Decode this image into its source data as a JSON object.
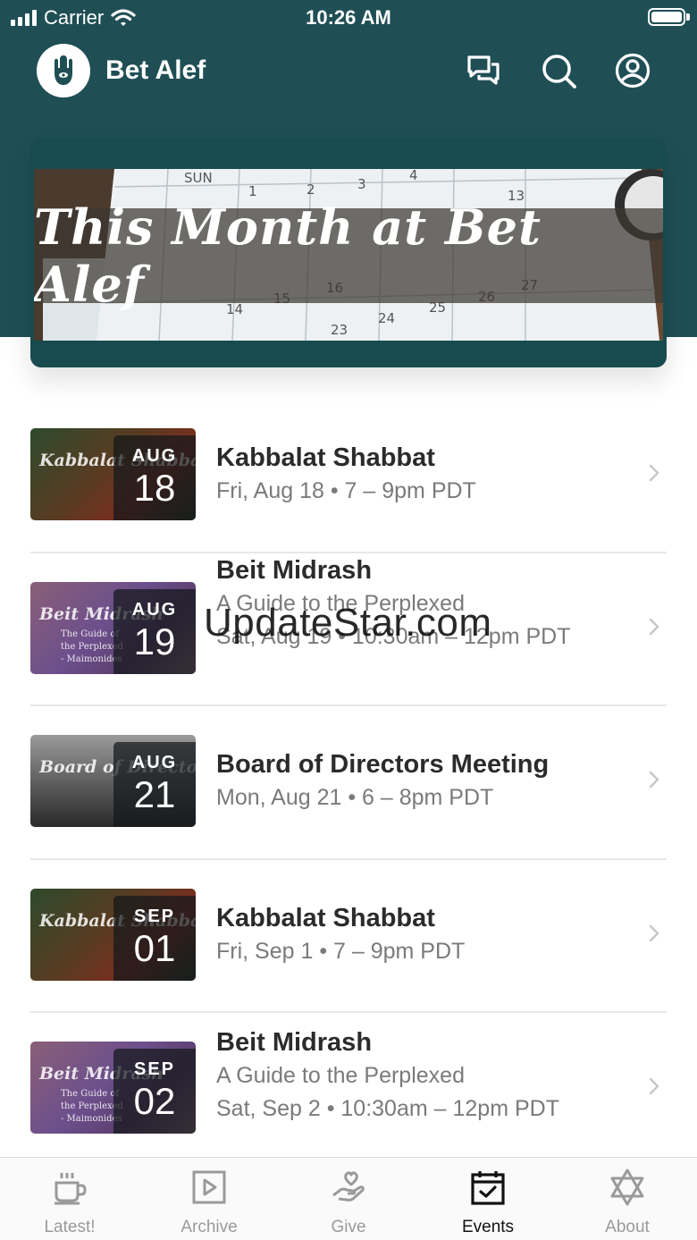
{
  "status_bar": {
    "carrier": "Carrier",
    "time": "10:26 AM"
  },
  "app": {
    "title": "Bet Alef"
  },
  "banner": {
    "title": "This Month at Bet Alef"
  },
  "events": [
    {
      "month": "AUG",
      "day": "18",
      "title": "Kabbalat Shabbat",
      "subtitle": "",
      "when": "Fri, Aug 18 • 7 – 9pm PDT",
      "thumb_text": "Kabbalat Shabbat",
      "thumb_sub": ""
    },
    {
      "month": "AUG",
      "day": "19",
      "title": "Beit Midrash",
      "subtitle": "A Guide to the Perplexed",
      "when": "Sat, Aug 19 • 10:30am – 12pm PDT",
      "thumb_text": "Beit Midrash",
      "thumb_sub": "The Guide of the Perplexed - Maimonides"
    },
    {
      "month": "AUG",
      "day": "21",
      "title": "Board of Directors Meeting",
      "subtitle": "",
      "when": "Mon, Aug 21 • 6 – 8pm PDT",
      "thumb_text": "Board of Directors",
      "thumb_sub": ""
    },
    {
      "month": "SEP",
      "day": "01",
      "title": "Kabbalat Shabbat",
      "subtitle": "",
      "when": "Fri, Sep 1 • 7 – 9pm PDT",
      "thumb_text": "Kabbalat Shabbat",
      "thumb_sub": ""
    },
    {
      "month": "SEP",
      "day": "02",
      "title": "Beit Midrash",
      "subtitle": "A Guide to the Perplexed",
      "when": "Sat, Sep 2 • 10:30am – 12pm PDT",
      "thumb_text": "Beit Midrash",
      "thumb_sub": "The Guide of the Perplexed - Maimonides"
    }
  ],
  "watermark": "UpdateStar.com",
  "tabs": [
    {
      "label": "Latest!",
      "icon": "coffee-cup-icon",
      "active": false
    },
    {
      "label": "Archive",
      "icon": "play-square-icon",
      "active": false
    },
    {
      "label": "Give",
      "icon": "heart-hand-icon",
      "active": false
    },
    {
      "label": "Events",
      "icon": "calendar-check-icon",
      "active": true
    },
    {
      "label": "About",
      "icon": "star-of-david-icon",
      "active": false
    }
  ],
  "colors": {
    "header": "#1f4f55",
    "active_tab": "#111111",
    "inactive_tab": "#9a9a9a"
  }
}
